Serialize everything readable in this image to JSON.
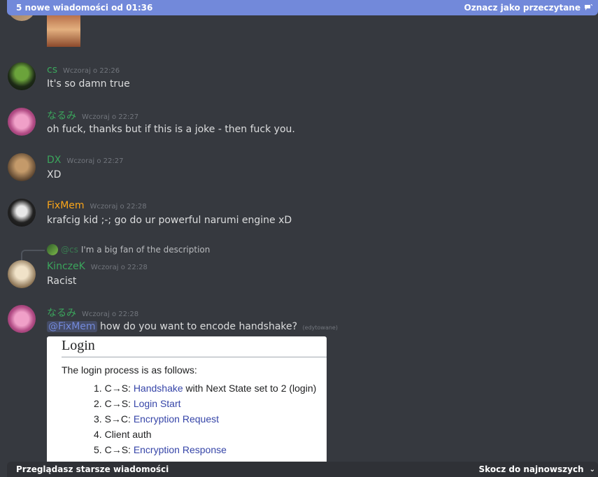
{
  "banner": {
    "text": "5 nowe wiadomości od 01:36",
    "mark_read": "Oznacz jako przeczytane"
  },
  "messages": [
    {
      "author": "cs",
      "timestamp": "Wczoraj o 22:26",
      "text": "It's so damn true",
      "name_color": "#3ba55c"
    },
    {
      "author": "なるみ",
      "timestamp": "Wczoraj o 22:27",
      "text": "oh fuck, thanks but if this is a joke - then fuck you.",
      "name_color": "#3ba55c"
    },
    {
      "author": "DX",
      "timestamp": "Wczoraj o 22:27",
      "text": "XD",
      "name_color": "#3ba55c"
    },
    {
      "author": "FixMem",
      "timestamp": "Wczoraj o 22:28",
      "text": "krafcig kid ;-; go do ur powerful narumi engine xD",
      "name_color": "#faa61a"
    },
    {
      "author": "KinczeK",
      "timestamp": "Wczoraj o 22:28",
      "text": "Racist",
      "name_color": "#3ba55c",
      "reply": {
        "author": "@cs",
        "text": "I'm a big fan of the description"
      }
    },
    {
      "author": "なるみ",
      "timestamp": "Wczoraj o 22:28",
      "mention": "@FixMem",
      "text": "how do you want to encode handshake?",
      "edited": "(edytowane)",
      "name_color": "#3ba55c"
    }
  ],
  "embed": {
    "heading": "Login",
    "intro": "The login process is as follows:",
    "steps": [
      {
        "num": "1.",
        "prefix": "C→S: ",
        "link": "Handshake",
        "suffix": " with Next State set to 2 (login)"
      },
      {
        "num": "2.",
        "prefix": "C→S: ",
        "link": "Login Start",
        "suffix": ""
      },
      {
        "num": "3.",
        "prefix": "S→C: ",
        "link": "Encryption Request",
        "suffix": ""
      },
      {
        "num": "4.",
        "prefix": "Client auth",
        "link": "",
        "suffix": ""
      },
      {
        "num": "5.",
        "prefix": "C→S: ",
        "link": "Encryption Response",
        "suffix": ""
      }
    ]
  },
  "bottom_bar": {
    "text": "Przeglądasz starsze wiadomości",
    "jump": "Skocz do najnowszych"
  },
  "colors": {
    "background": "#36393f",
    "banner": "#7289da",
    "bottom_bar": "#2f3136",
    "role_green": "#3ba55c",
    "role_yellow": "#faa61a",
    "mention": "#7289da"
  }
}
